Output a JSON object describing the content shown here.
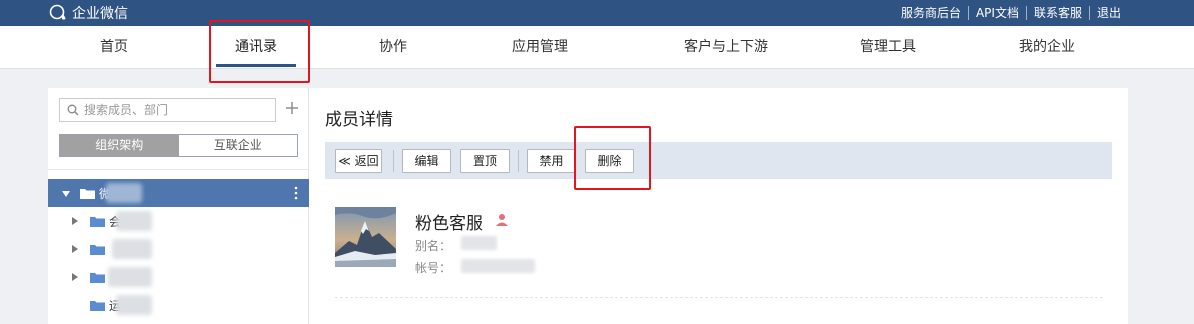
{
  "app": {
    "title": "企业微信"
  },
  "top_links": [
    "服务商后台",
    "API文档",
    "联系客服",
    "退出"
  ],
  "nav": {
    "items": [
      "首页",
      "通讯录",
      "协作",
      "应用管理",
      "客户与上下游",
      "管理工具",
      "我的企业"
    ],
    "active": "通讯录"
  },
  "sidebar": {
    "search_placeholder": "搜索成员、部门",
    "tabs": [
      "组织架构",
      "互联企业"
    ],
    "active_tab": "组织架构",
    "tree": [
      {
        "prefix": "微"
      },
      {
        "prefix": "会"
      },
      {
        "prefix": ""
      },
      {
        "prefix": ""
      },
      {
        "prefix": "运"
      }
    ]
  },
  "main": {
    "title": "成员详情",
    "toolbar": {
      "back": "≪ 返回",
      "edit": "编辑",
      "pin": "置顶",
      "disable": "禁用",
      "delete": "删除"
    },
    "member": {
      "name": "粉色客服",
      "alias_label": "别名：",
      "account_label": "帐号："
    }
  },
  "colors": {
    "header_bg": "#2f5383",
    "accent": "#4f76ad",
    "highlight": "#e3161f",
    "toolbar_bg": "#dfe6f0"
  },
  "icons": [
    "chat-bubble-logo-icon",
    "search-icon",
    "plus-icon",
    "caret-down-icon",
    "caret-right-icon",
    "folder-icon",
    "more-vertical-icon",
    "person-icon"
  ]
}
